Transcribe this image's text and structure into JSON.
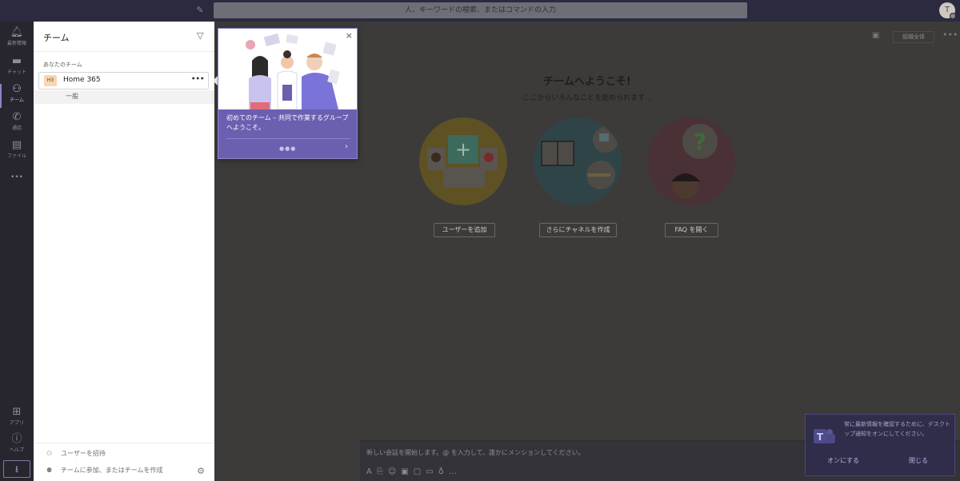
{
  "topbar": {
    "search_placeholder": "人、キーワードの検索、またはコマンドの入力",
    "avatar_initial": "T"
  },
  "rail": {
    "items": [
      {
        "label": "最新情報",
        "icon": "bell-icon"
      },
      {
        "label": "チャット",
        "icon": "chat-icon"
      },
      {
        "label": "チーム",
        "icon": "teams-icon"
      },
      {
        "label": "通話",
        "icon": "phone-icon"
      },
      {
        "label": "ファイル",
        "icon": "file-icon"
      },
      {
        "label": "アプリ",
        "icon": "apps-icon"
      },
      {
        "label": "ヘルプ",
        "icon": "help-icon"
      }
    ],
    "more": "•••"
  },
  "panel": {
    "title": "チーム",
    "section_label": "あなたのチーム",
    "team": {
      "initials": "H3",
      "name": "Home 365",
      "more": "•••"
    },
    "channel": "一般",
    "footer": {
      "invite": "ユーザーを招待",
      "join_create": "チームに参加、またはチームを作成"
    }
  },
  "main": {
    "org_button": "組織全体",
    "title": "チームへようこそ!",
    "subtitle": "ここからいろんなことを始められます...",
    "actions": [
      {
        "label": "ユーザーを追加"
      },
      {
        "label": "さらにチャネルを作成"
      },
      {
        "label": "FAQ を開く"
      }
    ],
    "composer_placeholder": "新しい会話を開始します。@ を入力して、誰かにメンションしてください。"
  },
  "coachmark": {
    "text": "初めてのチーム – 共同で作業するグループへようこそ。",
    "dots": "●●●",
    "next": "›",
    "close": "×"
  },
  "toast": {
    "text": "常に最新情報を確認するために、デスクトップ通知をオンにしてください。",
    "turn_on": "オンにする",
    "close": "閉じる"
  },
  "colors": {
    "accent": "#6b5fb0",
    "rail_bg": "#27262f",
    "topbar_bg": "#2b2a3f",
    "circle_yellow": "#caa632",
    "circle_teal": "#3f6b78",
    "circle_pink": "#a04e5e"
  }
}
